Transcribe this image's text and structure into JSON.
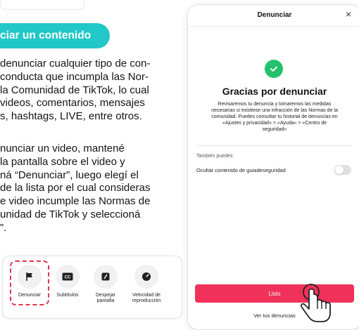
{
  "section": {
    "pill_text": "ciar un contenido",
    "paragraph1": "denunciar cualquier tipo de con-\nconducta que incumpla las Nor-\nla Comunidad de TikTok, lo cual\nvideos, comentarios, mensajes\ns, hashtags, LIVE, entre otros.",
    "paragraph2": "nunciar un video, mantené\nla pantalla sobre el video y\nná “Denunciar”, luego elegí el\nde la lista por el cual consideras\ne video incumple las Normas de\nunidad de TikTok y seleccioná\n”."
  },
  "options": [
    {
      "icon": "flag-icon",
      "label": "Denunciar"
    },
    {
      "icon": "cc-icon",
      "label": "Subtítulos"
    },
    {
      "icon": "clear-screen-icon",
      "label": "Despejar\npantalla"
    },
    {
      "icon": "speed-icon",
      "label": "Velocidad de\nreproducción"
    }
  ],
  "modal": {
    "title": "Denunciar",
    "close": "×",
    "thanks": "Gracias por denunciar",
    "description": "Revisaremos tu denuncia y tomaremos las medidas\nnecesarias si existiese una infracción de las Normas de la\ncomunidad. Puedes consultar tu historial de denuncias en\n«Ajustes y privacidad» > «Ayuda» > «Centro de\nseguridad»",
    "also_label": "También puedes:",
    "hide_label": "Ocultar contenido de guiadeseguridad",
    "toggle_on": false,
    "primary_button": "Listo",
    "secondary_link": "Ver tus denuncias"
  },
  "colors": {
    "accent_teal": "#22c7c7",
    "primary_red": "#f0325a",
    "success_green": "#23c16b",
    "highlight_red": "#e4334f"
  }
}
